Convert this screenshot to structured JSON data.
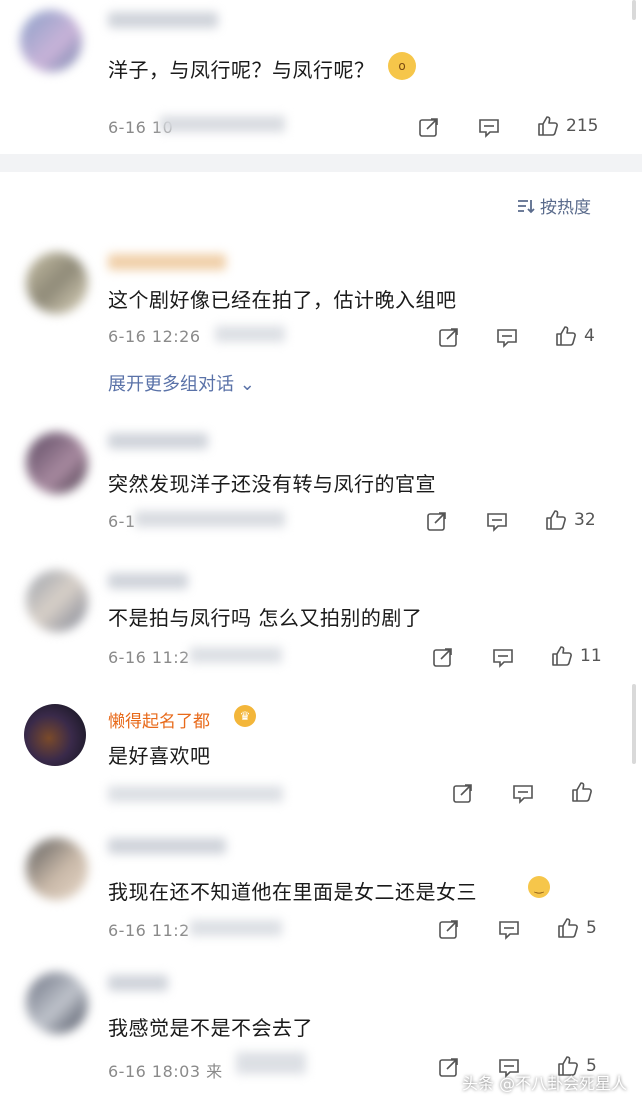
{
  "top_comment": {
    "text": "洋子，与凤行呢？与凤行呢？",
    "date": "6-16 10",
    "likes": "215"
  },
  "sort": {
    "label": "按热度"
  },
  "comments": [
    {
      "text": "这个剧好像已经在拍了，估计晚入组吧",
      "date": "6-16 12:26",
      "likes": "4",
      "expand": "展开更多组对话"
    },
    {
      "text": "突然发现洋子还没有转与凤行的官宣",
      "date": "6-1",
      "likes": "32"
    },
    {
      "text": "不是拍与凤行吗 怎么又拍别的剧了",
      "date": "6-16 11:2",
      "likes": "11"
    },
    {
      "username": "懒得起名了都",
      "text": "是好喜欢吧",
      "date": "",
      "likes": ""
    },
    {
      "text": "我现在还不知道他在里面是女二还是女三",
      "date": "6-16 11:2",
      "likes": "5"
    },
    {
      "text": "我感觉是不是不会去了",
      "date": "6-16 18:03 来",
      "likes": "5"
    }
  ],
  "watermark": "头条 @不八卦会死星人",
  "colors": {
    "link": "#5a72a8",
    "vip_name": "#e86a1a",
    "band": "#f2f3f5"
  }
}
